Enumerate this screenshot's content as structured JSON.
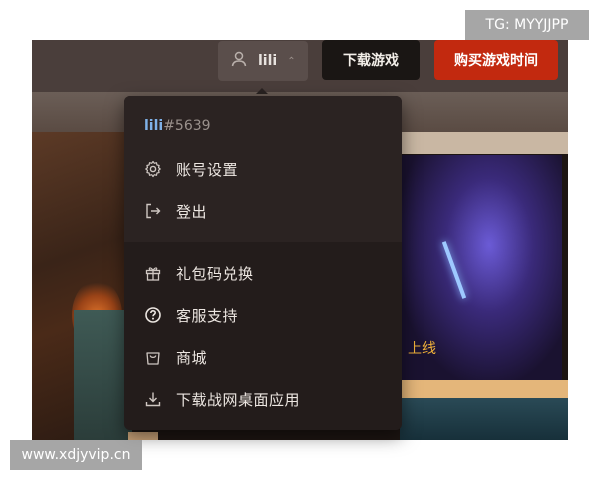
{
  "header": {
    "username": "lili",
    "download_label": "下载游戏",
    "buy_label": "购买游戏时间"
  },
  "menu": {
    "user_name": "lili",
    "user_tag": "#5639",
    "items": [
      {
        "label": "账号设置",
        "icon": "gear-icon"
      },
      {
        "label": "登出",
        "icon": "logout-icon"
      },
      {
        "label": "礼包码兑换",
        "icon": "gift-icon"
      },
      {
        "label": "客服支持",
        "icon": "help-circle-icon"
      },
      {
        "label": "商城",
        "icon": "shopping-bag-icon"
      },
      {
        "label": "下载战网桌面应用",
        "icon": "download-icon"
      }
    ]
  },
  "background": {
    "card_caption": "上线"
  },
  "watermarks": {
    "tg": "TG: MYYJJPP",
    "site": "www.xdjyvip.cn"
  },
  "colors": {
    "buy_button": "#c2290f",
    "download_button": "#1a1614",
    "menu_bg": "#231c1b",
    "username_accent": "#7fb1e8",
    "caption": "#f0b13a"
  }
}
